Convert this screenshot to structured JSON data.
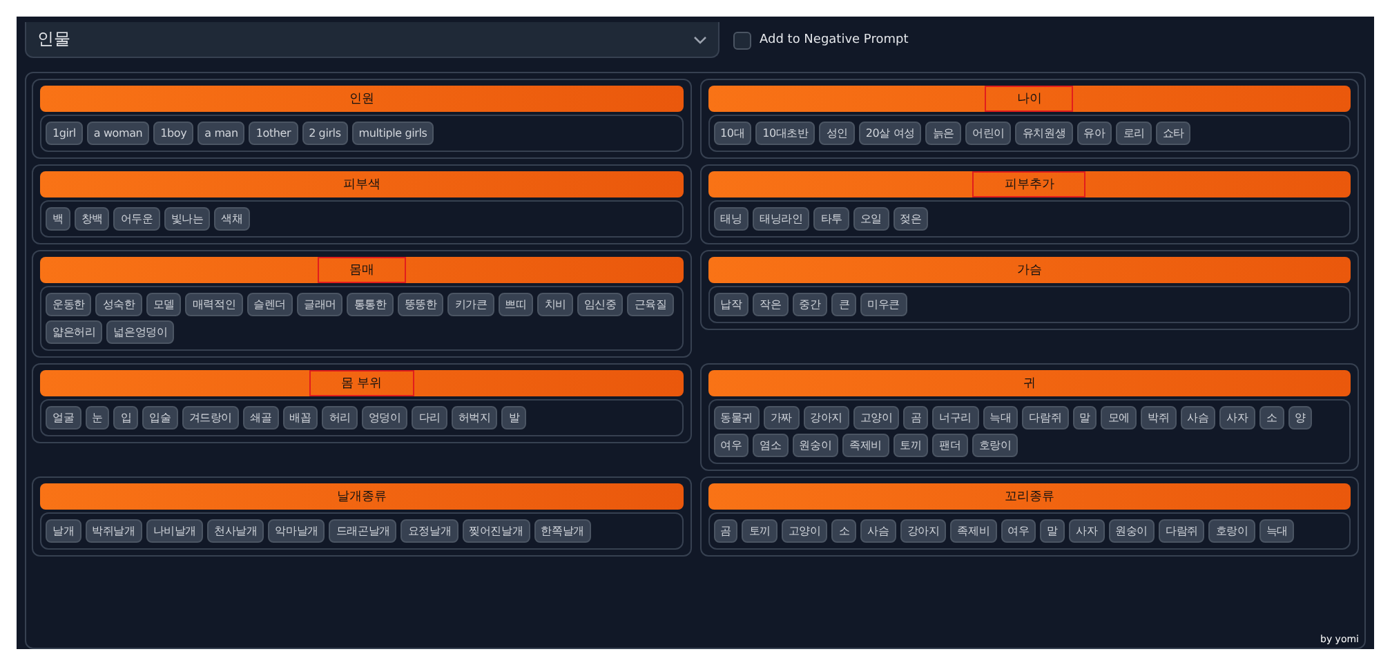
{
  "dropdown": {
    "value": "인물"
  },
  "negative_checkbox": {
    "label": "Add to Negative Prompt",
    "checked": false
  },
  "sections": [
    {
      "title": "인원",
      "highlighted": false,
      "tags": [
        "1girl",
        "a woman",
        "1boy",
        "a man",
        "1other",
        "2 girls",
        "multiple girls"
      ]
    },
    {
      "title": "나이",
      "highlighted": true,
      "tags": [
        "10대",
        "10대초반",
        "성인",
        "20살 여성",
        "늙은",
        "어린이",
        "유치원생",
        "유아",
        "로리",
        "쇼타"
      ]
    },
    {
      "title": "피부색",
      "highlighted": false,
      "tags": [
        "백",
        "창백",
        "어두운",
        "빛나는",
        "색채"
      ]
    },
    {
      "title": "피부추가",
      "highlighted": true,
      "tags": [
        "태닝",
        "태닝라인",
        "타투",
        "오일",
        "젖은"
      ]
    },
    {
      "title": "몸매",
      "highlighted": true,
      "tags": [
        "운동한",
        "성숙한",
        "모델",
        "매력적인",
        "슬렌더",
        "글래머",
        "통통한",
        "뚱뚱한",
        "키가큰",
        "쁘띠",
        "치비",
        "임신중",
        "근육질",
        "얇은허리",
        "넓은엉덩이"
      ]
    },
    {
      "title": "가슴",
      "highlighted": false,
      "tags": [
        "납작",
        "작은",
        "중간",
        "큰",
        "미우큰"
      ]
    },
    {
      "title": "몸 부위",
      "highlighted": true,
      "tags": [
        "얼굴",
        "눈",
        "입",
        "입술",
        "겨드랑이",
        "쇄골",
        "배꼽",
        "허리",
        "엉덩이",
        "다리",
        "허벅지",
        "발"
      ]
    },
    {
      "title": "귀",
      "highlighted": false,
      "tags": [
        "동물귀",
        "가짜",
        "강아지",
        "고양이",
        "곰",
        "너구리",
        "늑대",
        "다람쥐",
        "말",
        "모에",
        "박쥐",
        "사슴",
        "사자",
        "소",
        "양",
        "여우",
        "염소",
        "원숭이",
        "족제비",
        "토끼",
        "팬더",
        "호랑이"
      ]
    },
    {
      "title": "날개종류",
      "highlighted": false,
      "tags": [
        "날개",
        "박쥐날개",
        "나비날개",
        "천사날개",
        "악마날개",
        "드래곤날개",
        "요정날개",
        "찢어진날개",
        "한쪽날개"
      ]
    },
    {
      "title": "꼬리종류",
      "highlighted": false,
      "tags": [
        "곰",
        "토끼",
        "고양이",
        "소",
        "사슴",
        "강아지",
        "족제비",
        "여우",
        "말",
        "사자",
        "원숭이",
        "다람쥐",
        "호랑이",
        "늑대"
      ]
    }
  ],
  "credit": "by yomi"
}
